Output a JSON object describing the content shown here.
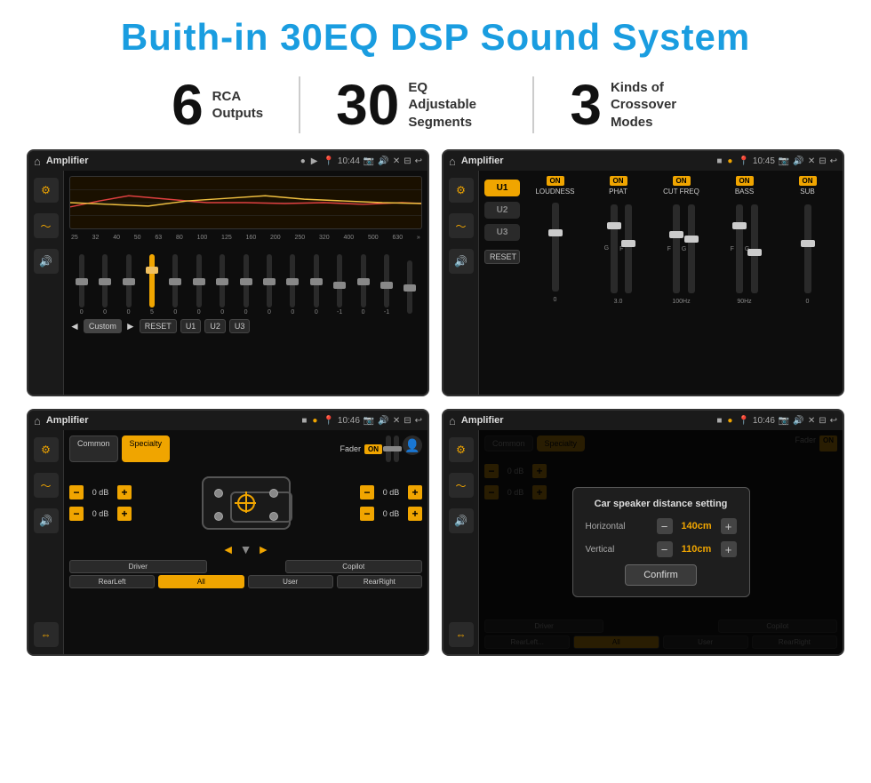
{
  "header": {
    "title": "Buith-in 30EQ DSP Sound System"
  },
  "stats": [
    {
      "number": "6",
      "label": "RCA\nOutputs"
    },
    {
      "number": "30",
      "label": "EQ Adjustable\nSegments"
    },
    {
      "number": "3",
      "label": "Kinds of\nCrossover Modes"
    }
  ],
  "screens": [
    {
      "id": "eq-screen",
      "app_name": "Amplifier",
      "time": "10:44",
      "type": "eq"
    },
    {
      "id": "crossover-screen",
      "app_name": "Amplifier",
      "time": "10:45",
      "type": "crossover"
    },
    {
      "id": "fader-screen",
      "app_name": "Amplifier",
      "time": "10:46",
      "type": "fader"
    },
    {
      "id": "distance-screen",
      "app_name": "Amplifier",
      "time": "10:46",
      "type": "distance"
    }
  ],
  "eq": {
    "freqs": [
      "25",
      "32",
      "40",
      "50",
      "63",
      "80",
      "100",
      "125",
      "160",
      "200",
      "250",
      "320",
      "400",
      "500",
      "630"
    ],
    "vals": [
      "0",
      "0",
      "0",
      "5",
      "0",
      "0",
      "0",
      "0",
      "0",
      "0",
      "0",
      "-1",
      "0",
      "-1",
      ""
    ],
    "preset": "Custom",
    "buttons": [
      "RESET",
      "U1",
      "U2",
      "U3"
    ]
  },
  "crossover": {
    "units": [
      "U1",
      "U2",
      "U3"
    ],
    "modules": [
      "LOUDNESS",
      "PHAT",
      "CUT FREQ",
      "BASS",
      "SUB"
    ]
  },
  "fader": {
    "tabs": [
      "Common",
      "Specialty"
    ],
    "active_tab": "Specialty",
    "fader_label": "Fader",
    "fader_on": "ON",
    "db_values": [
      "0 dB",
      "0 dB",
      "0 dB",
      "0 dB"
    ],
    "bottom_buttons": [
      "Driver",
      "",
      "",
      "",
      "Copilot",
      "RearLeft",
      "All",
      "User",
      "RearRight"
    ]
  },
  "distance_modal": {
    "title": "Car speaker distance setting",
    "horizontal_label": "Horizontal",
    "horizontal_value": "140cm",
    "vertical_label": "Vertical",
    "vertical_value": "110cm",
    "confirm_label": "Confirm"
  }
}
